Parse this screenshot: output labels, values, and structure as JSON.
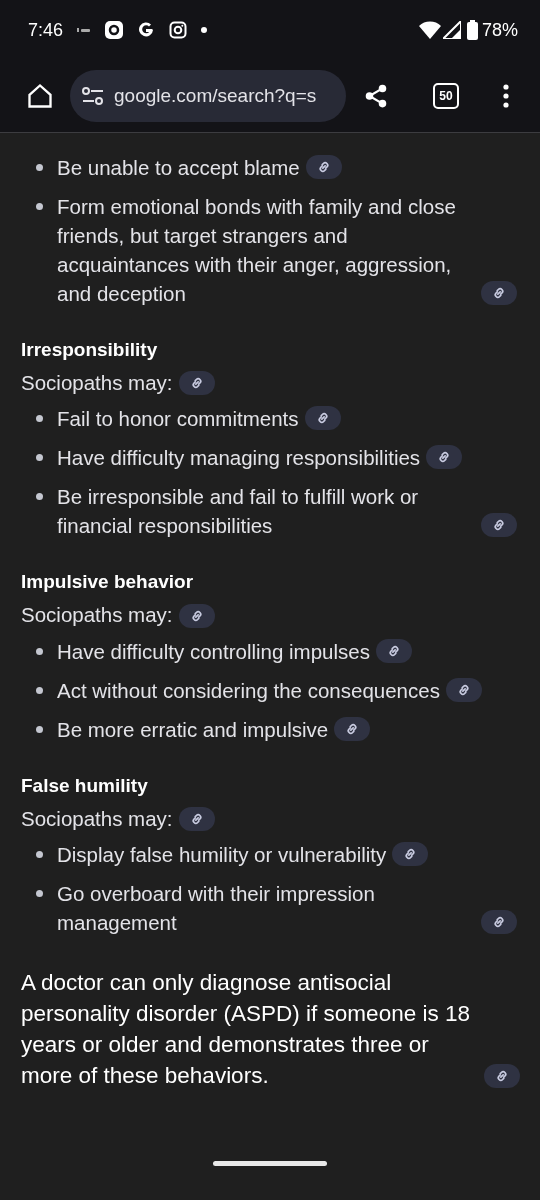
{
  "status_bar": {
    "time": "7:46",
    "battery": "78%"
  },
  "toolbar": {
    "url": "google.com/search?q=s",
    "tab_count": "50"
  },
  "sections": [
    {
      "items": [
        "Be unable to accept blame",
        "Form emotional bonds with family and close friends, but target strangers and acquaintances with their anger, aggression, and deception"
      ]
    },
    {
      "heading": "Irresponsibility",
      "intro": "Sociopaths may:",
      "items": [
        "Fail to honor commitments",
        "Have difficulty managing responsibilities",
        "Be irresponsible and fail to fulfill work or financial responsibilities"
      ]
    },
    {
      "heading": "Impulsive behavior",
      "intro": "Sociopaths may:",
      "items": [
        "Have difficulty controlling impulses",
        "Act without considering the consequences",
        "Be more erratic and impulsive"
      ]
    },
    {
      "heading": "False humility",
      "intro": "Sociopaths may:",
      "items": [
        "Display false humility or vulnerability",
        "Go overboard with their impression management"
      ]
    }
  ],
  "conclusion": "A doctor can only diagnose antisocial personality disorder (ASPD) if someone is 18 years or older and demonstrates three or more of these behaviors."
}
